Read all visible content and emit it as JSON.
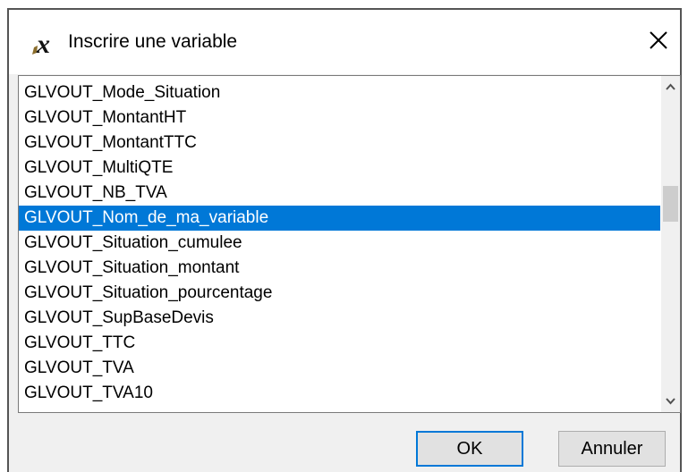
{
  "window": {
    "title": "Inscrire une variable",
    "icon": "italic-x-icon",
    "close_icon": "close-icon"
  },
  "list": {
    "items": [
      "GLVOUT_Mode_Situation",
      "GLVOUT_MontantHT",
      "GLVOUT_MontantTTC",
      "GLVOUT_MultiQTE",
      "GLVOUT_NB_TVA",
      "GLVOUT_Nom_de_ma_variable",
      "GLVOUT_Situation_cumulee",
      "GLVOUT_Situation_montant",
      "GLVOUT_Situation_pourcentage",
      "GLVOUT_SupBaseDevis",
      "GLVOUT_TTC",
      "GLVOUT_TVA",
      "GLVOUT_TVA10"
    ],
    "selected": "GLVOUT_Nom_de_ma_variable",
    "selected_color": "#0078d7"
  },
  "buttons": {
    "ok_label": "OK",
    "cancel_label": "Annuler"
  }
}
